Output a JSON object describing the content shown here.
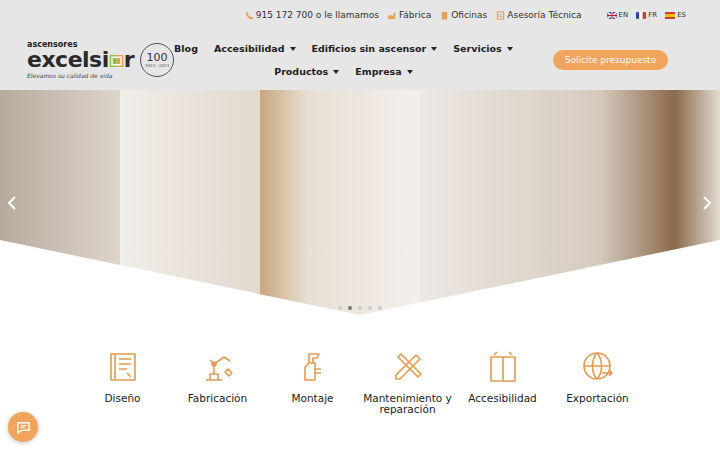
{
  "top_bar": {
    "links": [
      {
        "label": "915 172 700 o le llamamos"
      },
      {
        "label": "Fábrica"
      },
      {
        "label": "Oficinas"
      },
      {
        "label": "Asesoría Técnica"
      }
    ],
    "languages": [
      {
        "code": "EN"
      },
      {
        "code": "FR"
      },
      {
        "code": "ES"
      }
    ]
  },
  "logo": {
    "small": "ascensores",
    "name_start": "excelsi",
    "name_end": "r",
    "tagline": "Elevamos su calidad de vida",
    "badge_number": "100",
    "badge_years": "1923 · 2023"
  },
  "nav": {
    "rows": [
      [
        {
          "label": "Blog",
          "dropdown": false
        },
        {
          "label": "Accesibilidad",
          "dropdown": true
        },
        {
          "label": "Edificios sin ascensor",
          "dropdown": true
        },
        {
          "label": "Servicios",
          "dropdown": true
        }
      ],
      [
        {
          "label": "Productos",
          "dropdown": true
        },
        {
          "label": "Empresa",
          "dropdown": true
        }
      ]
    ]
  },
  "cta": {
    "label": "Solicite presupuesto"
  },
  "carousel": {
    "dots": [
      {
        "selected": false
      },
      {
        "selected": true
      },
      {
        "selected": false
      },
      {
        "selected": false
      },
      {
        "selected": false
      }
    ]
  },
  "services": [
    {
      "label": "Diseño"
    },
    {
      "label": "Fabricación"
    },
    {
      "label": "Montaje"
    },
    {
      "label": "Mantenimiento y reparación"
    },
    {
      "label": "Accesibilidad"
    },
    {
      "label": "Exportación"
    }
  ]
}
